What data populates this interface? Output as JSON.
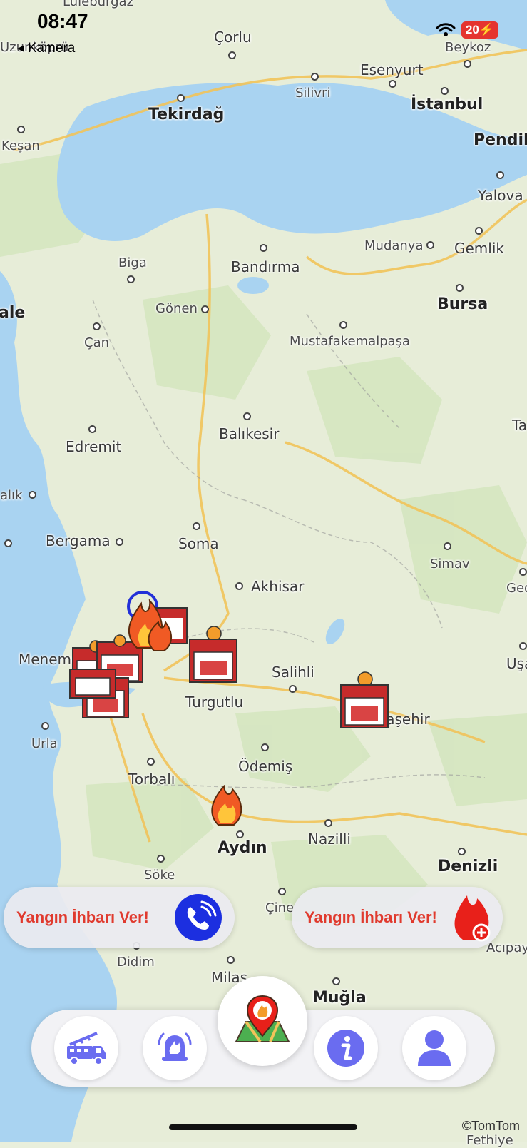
{
  "status": {
    "time": "08:47",
    "back_label": "◂ Kamera",
    "battery": "20"
  },
  "map": {
    "attribution": "©TomTom",
    "cities": [
      {
        "name": "Çorlu"
      },
      {
        "name": "Silivri"
      },
      {
        "name": "Esenyurt"
      },
      {
        "name": "İstanbul"
      },
      {
        "name": "Beykoz"
      },
      {
        "name": "Pendik"
      },
      {
        "name": "Tekirdağ"
      },
      {
        "name": "Keşan"
      },
      {
        "name": "Yalova"
      },
      {
        "name": "Gemlik"
      },
      {
        "name": "Mudanya"
      },
      {
        "name": "Bursa"
      },
      {
        "name": "Biga"
      },
      {
        "name": "Bandırma"
      },
      {
        "name": "Gönen"
      },
      {
        "name": "Çan"
      },
      {
        "name": "Mustafakemalpaşa"
      },
      {
        "name": "Balıkesir"
      },
      {
        "name": "Edremit"
      },
      {
        "name": "Bergama"
      },
      {
        "name": "Soma"
      },
      {
        "name": "Akhisar"
      },
      {
        "name": "Simav"
      },
      {
        "name": "Menemen"
      },
      {
        "name": "Turgutlu"
      },
      {
        "name": "Salihli"
      },
      {
        "name": "Alaşehir"
      },
      {
        "name": "Urla"
      },
      {
        "name": "Torbalı"
      },
      {
        "name": "Ödemiş"
      },
      {
        "name": "Aydın"
      },
      {
        "name": "Nazilli"
      },
      {
        "name": "Denizli"
      },
      {
        "name": "Söke"
      },
      {
        "name": "Çine"
      },
      {
        "name": "Didim"
      },
      {
        "name": "Milas"
      },
      {
        "name": "Muğla"
      },
      {
        "name": "Acıpayam"
      },
      {
        "name": "Fethiye"
      },
      {
        "name": "Uzunköprü"
      },
      {
        "name": "ale"
      },
      {
        "name": "alık"
      },
      {
        "name": "Ta"
      },
      {
        "name": "Ged"
      },
      {
        "name": "Uşa"
      },
      {
        "name": "Lüleburgaz"
      }
    ]
  },
  "actions": {
    "report_call_label": "Yangın İhbarı Ver!",
    "report_add_label": "Yangın İhbarı Ver!"
  },
  "nav": {
    "items": [
      {
        "icon": "fire-truck-icon"
      },
      {
        "icon": "alarm-bell-icon"
      },
      {
        "icon": "map-pin-icon"
      },
      {
        "icon": "info-icon"
      },
      {
        "icon": "user-icon"
      }
    ]
  },
  "colors": {
    "accent": "#6a6cf0",
    "report_text": "#e03a2e",
    "call_blue": "#1c2fe0",
    "fire_red": "#e8201a"
  }
}
